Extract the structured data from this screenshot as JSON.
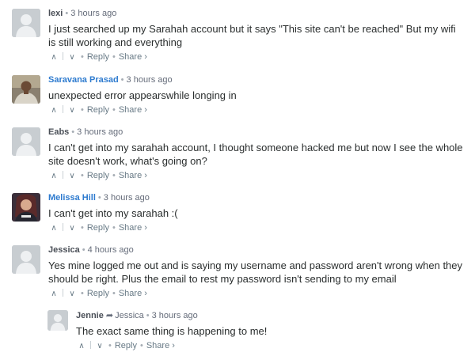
{
  "comments": [
    {
      "author": "lexi",
      "time": "3 hours ago",
      "text": "I just searched up my Sarahah account but it says \"This site can't be reached\" But my wifi is still working and everything",
      "reply": "Reply",
      "share": "Share ›"
    },
    {
      "author": "Saravana Prasad",
      "time": "3 hours ago",
      "text": "unexpected error appearswhile longing in",
      "reply": "Reply",
      "share": "Share ›"
    },
    {
      "author": "Eabs",
      "time": "3 hours ago",
      "text": "I can't get into my sarahah account, I thought someone hacked me but now I see the whole site doesn't work, what's going on?",
      "reply": "Reply",
      "share": "Share ›"
    },
    {
      "author": "Melissa Hill",
      "time": "3 hours ago",
      "text": "I can't get into my sarahah :(",
      "reply": "Reply",
      "share": "Share ›"
    },
    {
      "author": "Jessica",
      "time": "4 hours ago",
      "text": "Yes mine logged me out and is saying my username and password aren't wrong when they should be right. Plus the email to rest my password isn't sending to my email",
      "reply": "Reply",
      "share": "Share ›"
    },
    {
      "author": "Jennie",
      "in_reply_to": "Jessica",
      "time": "3 hours ago",
      "text": "The exact same thing is happening to me!",
      "reply": "Reply",
      "share": "Share ›"
    }
  ],
  "glyphs": {
    "separator": "•",
    "upvote": "∧",
    "downvote": "∨",
    "reply_arrow": "➦"
  },
  "colors": {
    "author_link": "#2e7bcf",
    "placeholder_avatar": "#c8cdd1",
    "meta_text": "#656c7a"
  }
}
